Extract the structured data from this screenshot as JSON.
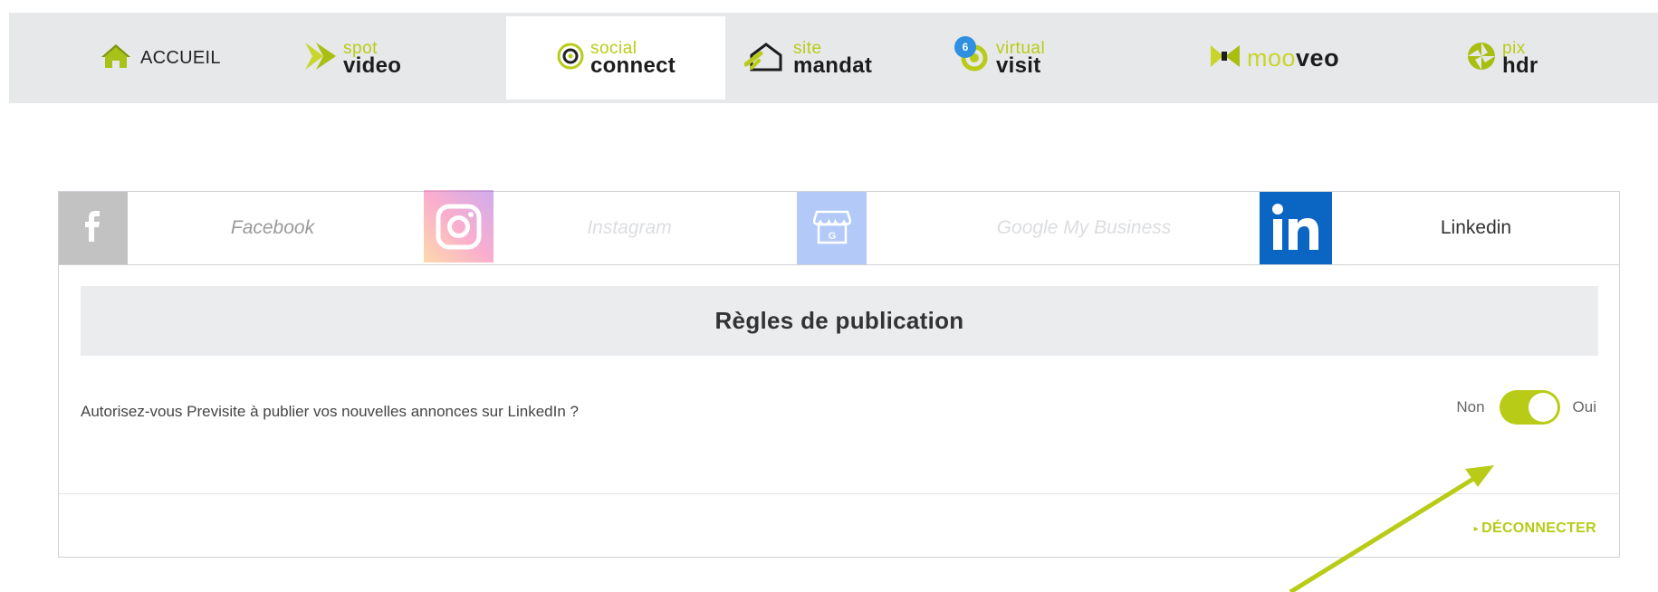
{
  "nav": {
    "accueil": "ACCUEIL",
    "spot": {
      "small": "spot",
      "big": "video"
    },
    "social": {
      "small": "social",
      "big": "connect"
    },
    "site": {
      "small": "site",
      "big": "mandat"
    },
    "virtual": {
      "small": "virtual",
      "big": "visit",
      "badge": "6"
    },
    "mooveo": {
      "part1": "moo",
      "part2": "veo"
    },
    "pix": {
      "small": "pix",
      "big": "hdr"
    }
  },
  "tabs": {
    "facebook": "Facebook",
    "instagram": "Instagram",
    "gmb": "Google My Business",
    "linkedin": "Linkedin"
  },
  "rules": {
    "title": "Règles de publication",
    "question": "Autorisez-vous Previsite à publier vos nouvelles annonces sur LinkedIn ?",
    "toggle_off": "Non",
    "toggle_on": "Oui",
    "toggle_state": "on"
  },
  "footer": {
    "disconnect": "DÉCONNECTER"
  },
  "icons": {
    "home": "home-icon",
    "spot": "play-chevrons-icon",
    "social": "social-connect-icon",
    "site": "house-icon",
    "virtual": "virtual-visit-icon",
    "mooveo": "mooveo-icon",
    "pix": "aperture-icon",
    "facebook": "facebook-icon",
    "instagram": "instagram-icon",
    "gmb": "storefront-icon",
    "linkedin": "linkedin-icon"
  },
  "colors": {
    "accent": "#b8cc17",
    "linkedin": "#0a66c2",
    "nav_bg": "#e7e8ea"
  }
}
